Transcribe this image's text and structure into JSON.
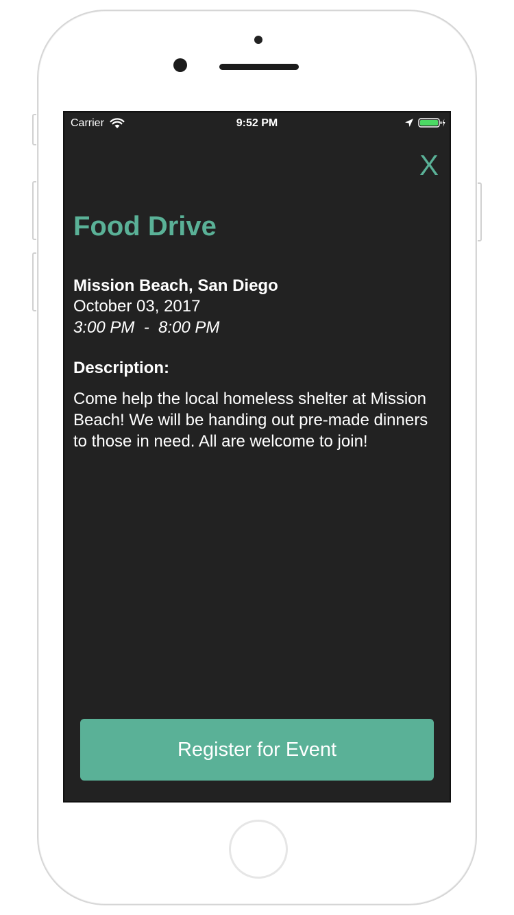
{
  "status_bar": {
    "carrier": "Carrier",
    "time": "9:52 PM"
  },
  "close_label": "X",
  "event": {
    "title": "Food Drive",
    "location": "Mission Beach, San Diego",
    "date": "October 03, 2017",
    "time_range": "3:00 PM  -  8:00 PM",
    "description_heading": "Description:",
    "description": "Come help the local homeless shelter at Mission Beach! We will be handing out pre-made dinners to those in need. All are welcome to join!"
  },
  "register_label": "Register for Event",
  "colors": {
    "accent": "#5ab197",
    "background": "#222222",
    "text": "#ffffff"
  },
  "icons": [
    "wifi-icon",
    "location-arrow-icon",
    "battery-icon",
    "charging-bolt-icon"
  ]
}
